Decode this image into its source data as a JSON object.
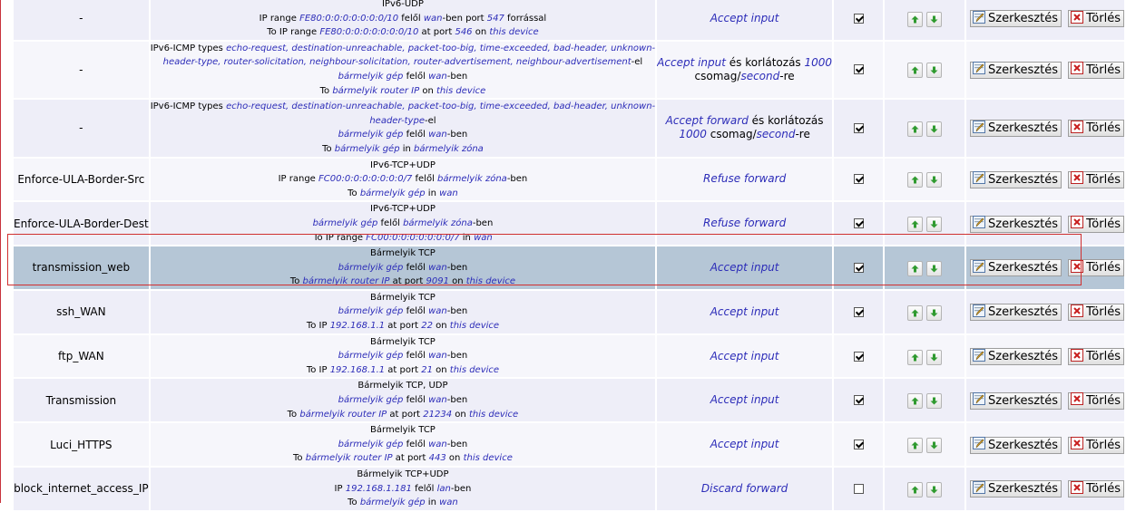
{
  "labels": {
    "edit": "Szerkesztés",
    "delete": "Törlés"
  },
  "colors": {
    "value_text": "#2c2cb8",
    "selected_row": "#b5c6d6",
    "selection_border": "#d03030"
  },
  "rules": [
    {
      "name": "-",
      "match": [
        [
          [
            "IPv6-UDP",
            0
          ]
        ],
        [
          [
            "IP range ",
            0
          ],
          [
            "FE80:0:0:0:0:0:0:0/10",
            1
          ],
          [
            " felől ",
            0
          ],
          [
            "wan",
            1
          ],
          [
            "-ben port ",
            0
          ],
          [
            "547",
            1
          ],
          [
            " forrással",
            0
          ]
        ],
        [
          [
            "To IP range ",
            0
          ],
          [
            "FE80:0:0:0:0:0:0:0/10",
            1
          ],
          [
            " at port ",
            0
          ],
          [
            "546",
            1
          ],
          [
            " on ",
            0
          ],
          [
            "this device",
            1
          ]
        ]
      ],
      "target": [
        [
          [
            "Accept input",
            1
          ]
        ]
      ],
      "enabled": true,
      "highlighted": false
    },
    {
      "name": "-",
      "match": [
        [
          [
            "IPv6-ICMP types ",
            0
          ],
          [
            "echo-request, destination-unreachable, packet-too-big, time-exceeded, bad-header, unknown-",
            1
          ]
        ],
        [
          [
            "header-type, router-solicitation, neighbour-solicitation, router-advertisement, neighbour-advertisement",
            1
          ],
          [
            "-el",
            0
          ]
        ],
        [
          [
            "bármelyik gép",
            1
          ],
          [
            " felől ",
            0
          ],
          [
            "wan",
            1
          ],
          [
            "-ben",
            0
          ]
        ],
        [
          [
            "To ",
            0
          ],
          [
            "bármelyik router IP",
            1
          ],
          [
            " on ",
            0
          ],
          [
            "this device",
            1
          ]
        ]
      ],
      "target": [
        [
          [
            "Accept input",
            1
          ],
          [
            " és korlátozás ",
            0
          ],
          [
            "1000",
            1
          ]
        ],
        [
          [
            "csomag/",
            0
          ],
          [
            "second",
            1
          ],
          [
            "-re",
            0
          ]
        ]
      ],
      "enabled": true,
      "highlighted": false
    },
    {
      "name": "-",
      "match": [
        [
          [
            "IPv6-ICMP types ",
            0
          ],
          [
            "echo-request, destination-unreachable, packet-too-big, time-exceeded, bad-header, unknown-",
            1
          ]
        ],
        [
          [
            "header-type",
            1
          ],
          [
            "-el",
            0
          ]
        ],
        [
          [
            "bármelyik gép",
            1
          ],
          [
            " felől ",
            0
          ],
          [
            "wan",
            1
          ],
          [
            "-ben",
            0
          ]
        ],
        [
          [
            "To ",
            0
          ],
          [
            "bármelyik gép",
            1
          ],
          [
            " in ",
            0
          ],
          [
            "bármelyik zóna",
            1
          ]
        ]
      ],
      "target": [
        [
          [
            "Accept forward",
            1
          ],
          [
            " és korlátozás",
            0
          ]
        ],
        [
          [
            "1000",
            1
          ],
          [
            " csomag/",
            0
          ],
          [
            "second",
            1
          ],
          [
            "-re",
            0
          ]
        ]
      ],
      "enabled": true,
      "highlighted": false
    },
    {
      "name": "Enforce-ULA-Border-Src",
      "match": [
        [
          [
            "IPv6-TCP+UDP",
            0
          ]
        ],
        [
          [
            "IP range ",
            0
          ],
          [
            "FC00:0:0:0:0:0:0:0/7",
            1
          ],
          [
            " felől ",
            0
          ],
          [
            "bármelyik zóna",
            1
          ],
          [
            "-ben",
            0
          ]
        ],
        [
          [
            "To ",
            0
          ],
          [
            "bármelyik gép",
            1
          ],
          [
            " in ",
            0
          ],
          [
            "wan",
            1
          ]
        ]
      ],
      "target": [
        [
          [
            "Refuse forward",
            1
          ]
        ]
      ],
      "enabled": true,
      "highlighted": false
    },
    {
      "name": "Enforce-ULA-Border-Dest",
      "match": [
        [
          [
            "IPv6-TCP+UDP",
            0
          ]
        ],
        [
          [
            "bármelyik gép",
            1
          ],
          [
            " felől ",
            0
          ],
          [
            "bármelyik zóna",
            1
          ],
          [
            "-ben",
            0
          ]
        ],
        [
          [
            "To IP range ",
            0
          ],
          [
            "FC00:0:0:0:0:0:0:0/7",
            1
          ],
          [
            " in ",
            0
          ],
          [
            "wan",
            1
          ]
        ]
      ],
      "target": [
        [
          [
            "Refuse forward",
            1
          ]
        ]
      ],
      "enabled": true,
      "highlighted": false
    },
    {
      "name": "transmission_web",
      "match": [
        [
          [
            "Bármelyik TCP",
            0
          ]
        ],
        [
          [
            "bármelyik gép",
            1
          ],
          [
            " felől ",
            0
          ],
          [
            "wan",
            1
          ],
          [
            "-ben",
            0
          ]
        ],
        [
          [
            "To ",
            0
          ],
          [
            "bármelyik router IP",
            1
          ],
          [
            " at port ",
            0
          ],
          [
            "9091",
            1
          ],
          [
            " on ",
            0
          ],
          [
            "this device",
            1
          ]
        ]
      ],
      "target": [
        [
          [
            "Accept input",
            1
          ]
        ]
      ],
      "enabled": true,
      "highlighted": true
    },
    {
      "name": "ssh_WAN",
      "match": [
        [
          [
            "Bármelyik TCP",
            0
          ]
        ],
        [
          [
            "bármelyik gép",
            1
          ],
          [
            " felől ",
            0
          ],
          [
            "wan",
            1
          ],
          [
            "-ben",
            0
          ]
        ],
        [
          [
            "To IP ",
            0
          ],
          [
            "192.168.1.1",
            1
          ],
          [
            " at port ",
            0
          ],
          [
            "22",
            1
          ],
          [
            " on ",
            0
          ],
          [
            "this device",
            1
          ]
        ]
      ],
      "target": [
        [
          [
            "Accept input",
            1
          ]
        ]
      ],
      "enabled": true,
      "highlighted": false
    },
    {
      "name": "ftp_WAN",
      "match": [
        [
          [
            "Bármelyik TCP",
            0
          ]
        ],
        [
          [
            "bármelyik gép",
            1
          ],
          [
            " felől ",
            0
          ],
          [
            "wan",
            1
          ],
          [
            "-ben",
            0
          ]
        ],
        [
          [
            "To IP ",
            0
          ],
          [
            "192.168.1.1",
            1
          ],
          [
            " at port ",
            0
          ],
          [
            "21",
            1
          ],
          [
            " on ",
            0
          ],
          [
            "this device",
            1
          ]
        ]
      ],
      "target": [
        [
          [
            "Accept input",
            1
          ]
        ]
      ],
      "enabled": true,
      "highlighted": false
    },
    {
      "name": "Transmission",
      "match": [
        [
          [
            "Bármelyik TCP, UDP",
            0
          ]
        ],
        [
          [
            "bármelyik gép",
            1
          ],
          [
            " felől ",
            0
          ],
          [
            "wan",
            1
          ],
          [
            "-ben",
            0
          ]
        ],
        [
          [
            "To ",
            0
          ],
          [
            "bármelyik router IP",
            1
          ],
          [
            " at port ",
            0
          ],
          [
            "21234",
            1
          ],
          [
            " on ",
            0
          ],
          [
            "this device",
            1
          ]
        ]
      ],
      "target": [
        [
          [
            "Accept input",
            1
          ]
        ]
      ],
      "enabled": true,
      "highlighted": false
    },
    {
      "name": "Luci_HTTPS",
      "match": [
        [
          [
            "Bármelyik TCP",
            0
          ]
        ],
        [
          [
            "bármelyik gép",
            1
          ],
          [
            " felől ",
            0
          ],
          [
            "wan",
            1
          ],
          [
            "-ben",
            0
          ]
        ],
        [
          [
            "To ",
            0
          ],
          [
            "bármelyik router IP",
            1
          ],
          [
            " at port ",
            0
          ],
          [
            "443",
            1
          ],
          [
            " on ",
            0
          ],
          [
            "this device",
            1
          ]
        ]
      ],
      "target": [
        [
          [
            "Accept input",
            1
          ]
        ]
      ],
      "enabled": true,
      "highlighted": false
    },
    {
      "name": "block_internet_access_IP",
      "match": [
        [
          [
            "Bármelyik TCP+UDP",
            0
          ]
        ],
        [
          [
            "IP ",
            0
          ],
          [
            "192.168.1.181",
            1
          ],
          [
            " felől ",
            0
          ],
          [
            "lan",
            1
          ],
          [
            "-ben",
            0
          ]
        ],
        [
          [
            "To ",
            0
          ],
          [
            "bármelyik gép",
            1
          ],
          [
            " in ",
            0
          ],
          [
            "wan",
            1
          ]
        ]
      ],
      "target": [
        [
          [
            "Discard forward",
            1
          ]
        ]
      ],
      "enabled": false,
      "highlighted": false
    }
  ]
}
